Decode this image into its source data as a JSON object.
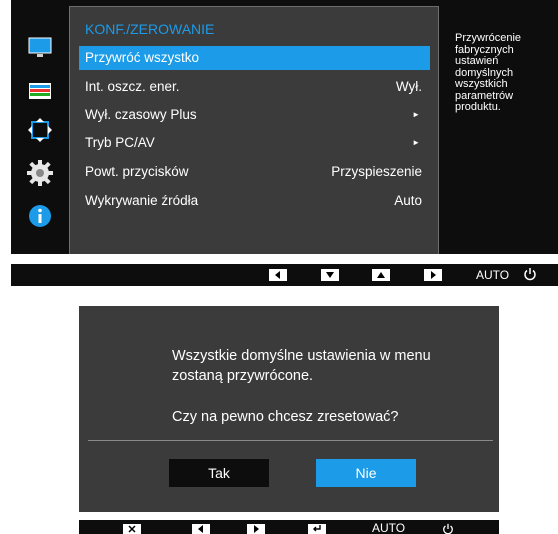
{
  "osd": {
    "title": "KONF./ZEROWANIE",
    "items": [
      {
        "label": "Przywróć wszystko",
        "value": "",
        "arrow": ""
      },
      {
        "label": "Int. oszcz. ener.",
        "value": "Wył.",
        "arrow": ""
      },
      {
        "label": "Wył. czasowy Plus",
        "value": "",
        "arrow": "►"
      },
      {
        "label": "Tryb PC/AV",
        "value": "",
        "arrow": "►"
      },
      {
        "label": "Powt. przycisków",
        "value": "Przyspieszenie",
        "arrow": ""
      },
      {
        "label": "Wykrywanie źródła",
        "value": "Auto",
        "arrow": ""
      }
    ],
    "description": "Przywrócenie fabrycznych ustawień domyślnych wszystkich parametrów produktu.",
    "rail_icons": [
      "monitor-icon",
      "color-bars-icon",
      "resize-arrows-icon",
      "gear-icon",
      "info-icon"
    ],
    "accent_color": "#1b9be8"
  },
  "navbar_top": {
    "auto_label": "AUTO",
    "buttons": [
      "left-arrow-icon",
      "down-arrow-icon",
      "up-arrow-icon",
      "right-arrow-icon",
      "power-icon"
    ]
  },
  "dialog": {
    "message_line1": "Wszystkie domyślne ustawienia w menu",
    "message_line2": "zostaną przywrócone.",
    "question": "Czy na pewno chcesz zresetować?",
    "yes_label": "Tak",
    "no_label": "Nie"
  },
  "navbar_bottom": {
    "auto_label": "AUTO",
    "buttons": [
      "close-icon",
      "left-arrow-icon",
      "right-arrow-icon",
      "enter-icon",
      "power-icon"
    ]
  }
}
